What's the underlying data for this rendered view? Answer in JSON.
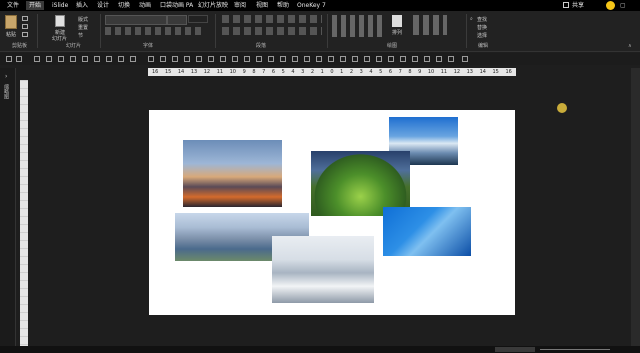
{
  "menu": {
    "tabs": [
      "文件",
      "开始",
      "iSlide",
      "插入",
      "设计",
      "切换",
      "动画",
      "口袋动画 PA",
      "幻灯片放映",
      "审阅",
      "视图",
      "帮助",
      "OneKey 7"
    ],
    "active_index": 1,
    "share": "共享"
  },
  "ribbon": {
    "paste": "粘贴",
    "new_slide_1": "新建",
    "new_slide_2": "幻灯片",
    "layout": "版式",
    "reset": "重置",
    "section": "节",
    "arrange": "排列",
    "find": "查找",
    "replace": "替换",
    "select": "选择",
    "groups": [
      "剪贴板",
      "幻灯片",
      "字体",
      "段落",
      "绘图",
      "编辑"
    ]
  },
  "ruler": {
    "labels": [
      "16",
      "15",
      "14",
      "13",
      "12",
      "11",
      "10",
      "9",
      "8",
      "7",
      "6",
      "5",
      "4",
      "3",
      "2",
      "1",
      "0",
      "1",
      "2",
      "3",
      "4",
      "5",
      "6",
      "7",
      "8",
      "9",
      "10",
      "11",
      "12",
      "13",
      "14",
      "15",
      "16"
    ]
  },
  "left_panel": {
    "label": "缩略图"
  },
  "colors": {
    "menubar": "#000000",
    "ribbon": "#222222",
    "canvas": "#1e1e1e",
    "slide": "#ffffff",
    "accent_user": "#f5c518"
  }
}
